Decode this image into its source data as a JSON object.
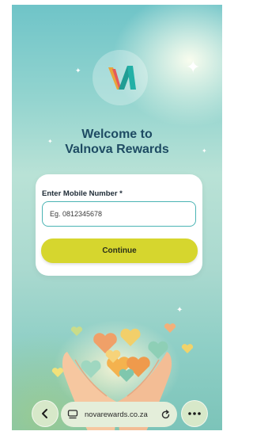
{
  "app": {
    "welcome_line1": "Welcome to",
    "welcome_line2": "Valnova Rewards"
  },
  "form": {
    "label": "Enter Mobile Number *",
    "placeholder": "Eg. 0812345678",
    "value": "",
    "continue_label": "Continue"
  },
  "browser": {
    "url": "novarewards.co.za"
  },
  "colors": {
    "accent_button": "#d6d62e",
    "heading": "#1e4b63",
    "input_border": "#4bb4b4"
  },
  "icons": [
    "logo-icon",
    "back-icon",
    "tabs-icon",
    "reload-icon",
    "more-icon",
    "hearts-hands-illustration"
  ]
}
